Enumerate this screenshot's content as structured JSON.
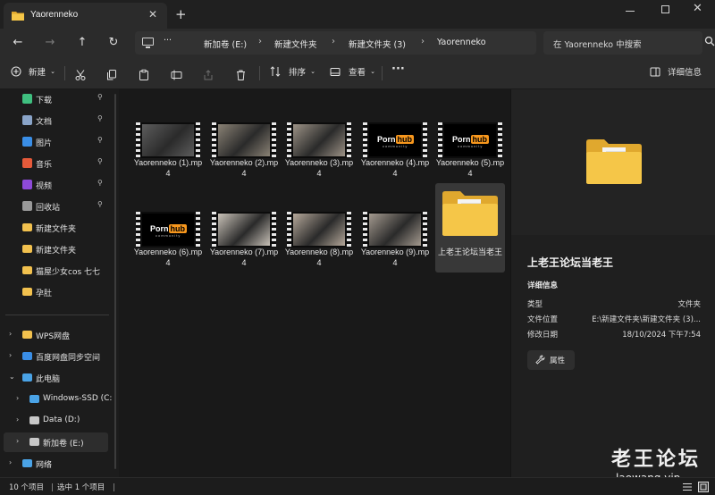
{
  "window": {
    "tab_title": "Yaorenneko",
    "new_tab": "+",
    "close_tab": "✕",
    "minimize": "—",
    "maximize": "☐",
    "close": "✕"
  },
  "nav": {
    "back": "←",
    "forward": "→",
    "up": "↑",
    "refresh": "↻",
    "more": "···",
    "breadcrumbs": [
      "新加卷 (E:)",
      "新建文件夹",
      "新建文件夹 (3)",
      "Yaorenneko"
    ],
    "separator": "›",
    "search_placeholder": "在 Yaorenneko 中搜索"
  },
  "toolbar": {
    "new_label": "新建",
    "sort_label": "排序",
    "view_label": "查看",
    "more": "···",
    "details_label": "详细信息"
  },
  "sidebar": {
    "quick_access": [
      {
        "label": "下载",
        "icon": "download-icon",
        "color": "#3fbf7f",
        "pinned": true
      },
      {
        "label": "文档",
        "icon": "document-icon",
        "color": "#8aa4c8",
        "pinned": true
      },
      {
        "label": "图片",
        "icon": "pictures-icon",
        "color": "#3a8ee6",
        "pinned": true
      },
      {
        "label": "音乐",
        "icon": "music-icon",
        "color": "#e65a3a",
        "pinned": true
      },
      {
        "label": "视频",
        "icon": "videos-icon",
        "color": "#8e4ad9",
        "pinned": true
      },
      {
        "label": "回收站",
        "icon": "recycle-bin-icon",
        "color": "#9a9a9a",
        "pinned": true
      },
      {
        "label": "新建文件夹",
        "icon": "folder-icon",
        "color": "#f2c14e",
        "pinned": false
      },
      {
        "label": "新建文件夹",
        "icon": "folder-icon",
        "color": "#f2c14e",
        "pinned": false
      },
      {
        "label": "猫屋少女cos 七七",
        "icon": "folder-icon",
        "color": "#f2c14e",
        "pinned": false
      },
      {
        "label": "孕肚",
        "icon": "folder-icon",
        "color": "#f2c14e",
        "pinned": false
      }
    ],
    "pin_glyph": "📌",
    "tree": [
      {
        "label": "WPS网盘",
        "icon": "cloud-folder-icon",
        "color": "#f2c14e",
        "chevron": "›",
        "indent": 0
      },
      {
        "label": "百度网盘同步空间",
        "icon": "baidu-netdisk-icon",
        "color": "#3a8ee6",
        "chevron": "›",
        "indent": 0
      },
      {
        "label": "此电脑",
        "icon": "this-pc-icon",
        "color": "#4aa3e6",
        "chevron": "⌄",
        "indent": 0
      },
      {
        "label": "Windows-SSD (C:",
        "icon": "drive-c-icon",
        "color": "#4aa3e6",
        "chevron": "›",
        "indent": 1
      },
      {
        "label": "Data (D:)",
        "icon": "drive-icon",
        "color": "#c8c8c8",
        "chevron": "›",
        "indent": 1
      },
      {
        "label": "新加卷 (E:)",
        "icon": "drive-icon",
        "color": "#c8c8c8",
        "chevron": "›",
        "indent": 1,
        "selected": true
      },
      {
        "label": "网络",
        "icon": "network-icon",
        "color": "#4aa3e6",
        "chevron": "›",
        "indent": 0
      }
    ]
  },
  "files": [
    {
      "name": "Yaorenneko (1).mp4",
      "thumb": "photo",
      "tone": "#5d5d5d"
    },
    {
      "name": "Yaorenneko (2).mp4",
      "thumb": "photo",
      "tone": "#8a8275"
    },
    {
      "name": "Yaorenneko (3).mp4",
      "thumb": "photo",
      "tone": "#9c9286"
    },
    {
      "name": "Yaorenneko (4).mp4",
      "thumb": "logo"
    },
    {
      "name": "Yaorenneko (5).mp4",
      "thumb": "logo"
    },
    {
      "name": "Yaorenneko (6).mp4",
      "thumb": "logo"
    },
    {
      "name": "Yaorenneko (7).mp4",
      "thumb": "photo",
      "tone": "#c9c2b8"
    },
    {
      "name": "Yaorenneko (8).mp4",
      "thumb": "photo",
      "tone": "#b5a89a"
    },
    {
      "name": "Yaorenneko (9).mp4",
      "thumb": "photo",
      "tone": "#a49a8f"
    },
    {
      "name": "上老王论坛当老王",
      "thumb": "folder",
      "selected": true
    }
  ],
  "logo_text": {
    "left": "Porn",
    "right": "hub",
    "sub": "community"
  },
  "details": {
    "title": "上老王论坛当老王",
    "section": "详细信息",
    "rows": [
      {
        "key": "类型",
        "value": "文件夹"
      },
      {
        "key": "文件位置",
        "value": "E:\\新建文件夹\\新建文件夹 (3)..."
      },
      {
        "key": "修改日期",
        "value": "18/10/2024 下午7:54"
      }
    ],
    "properties_label": "属性"
  },
  "watermark": {
    "text": "老王论坛",
    "url": "laowang.vip"
  },
  "status": {
    "count": "10 个项目",
    "selected": "选中 1 个项目"
  },
  "colors": {
    "folder": "#f5c648",
    "folder_back": "#e0a82e",
    "accent": "#f7971d"
  }
}
